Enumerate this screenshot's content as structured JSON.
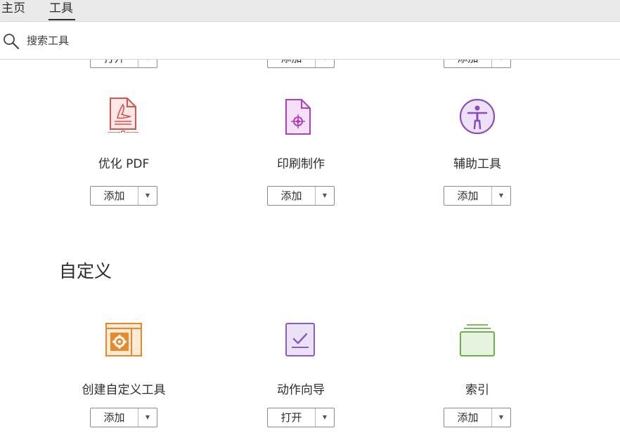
{
  "tabs": [
    {
      "label": "主页"
    },
    {
      "label": "工具",
      "active": true
    }
  ],
  "search": {
    "placeholder": "搜索工具"
  },
  "row_top": [
    {
      "button": "打开"
    },
    {
      "button": "添加"
    },
    {
      "button": "添加"
    }
  ],
  "row1": [
    {
      "label": "优化 PDF",
      "button": "添加",
      "icon": "optimize-pdf-icon",
      "color": "#d9534f"
    },
    {
      "label": "印刷制作",
      "button": "添加",
      "icon": "print-production-icon",
      "color": "#b13fbf"
    },
    {
      "label": "辅助工具",
      "button": "添加",
      "icon": "accessibility-icon",
      "color": "#8a4bbf"
    }
  ],
  "section": {
    "title": "自定义"
  },
  "row2": [
    {
      "label": "创建自定义工具",
      "button": "添加",
      "icon": "custom-tool-icon",
      "color": "#e8892b"
    },
    {
      "label": "动作向导",
      "button": "打开",
      "icon": "action-wizard-icon",
      "color": "#8a5bc0"
    },
    {
      "label": "索引",
      "button": "添加",
      "icon": "index-icon",
      "color": "#6ab04c"
    }
  ],
  "dropdown_arrow": "▼"
}
